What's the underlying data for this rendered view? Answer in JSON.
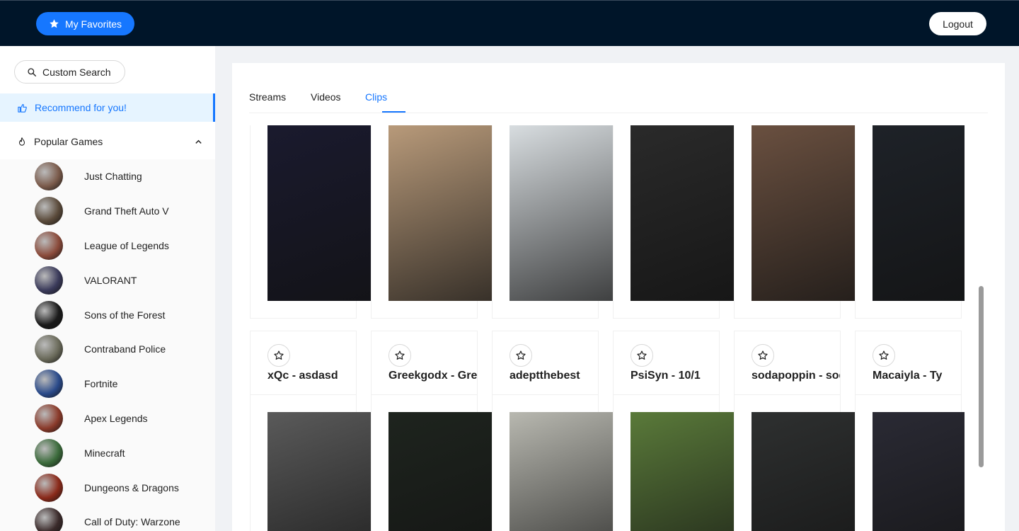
{
  "header": {
    "favorites_label": "My Favorites",
    "logout_label": "Logout"
  },
  "sidebar": {
    "custom_search_label": "Custom Search",
    "recommend_label": "Recommend for you!",
    "popular_label": "Popular Games",
    "games": [
      {
        "name": "Just Chatting",
        "color": "#7a5a4a"
      },
      {
        "name": "Grand Theft Auto V",
        "color": "#5a4a3a"
      },
      {
        "name": "League of Legends",
        "color": "#8a4a3a"
      },
      {
        "name": "VALORANT",
        "color": "#3a3a5a"
      },
      {
        "name": "Sons of the Forest",
        "color": "#1a1a1a"
      },
      {
        "name": "Contraband Police",
        "color": "#6a6a5a"
      },
      {
        "name": "Fortnite",
        "color": "#2a4a8a"
      },
      {
        "name": "Apex Legends",
        "color": "#8a3a2a"
      },
      {
        "name": "Minecraft",
        "color": "#3a6a3a"
      },
      {
        "name": "Dungeons & Dragons",
        "color": "#8a2a1a"
      },
      {
        "name": "Call of Duty: Warzone",
        "color": "#3a2a2a"
      }
    ]
  },
  "tabs": [
    "Streams",
    "Videos",
    "Clips"
  ],
  "active_tab": "Clips",
  "clips": [
    {
      "title": "xQc - asdasd",
      "thumb": "#1a1a2e"
    },
    {
      "title": "Greekgodx - Greekgodx",
      "thumb": "#b89a7a"
    },
    {
      "title": "adeptthebest",
      "thumb": "#d8dde0"
    },
    {
      "title": "PsiSyn - 10/1",
      "thumb": "#2a2a2a"
    },
    {
      "title": "sodapoppin - sodapoppin",
      "thumb": "#6a5040"
    },
    {
      "title": "Macaiyla - Ty",
      "thumb": "#1e2228"
    }
  ],
  "next_row_thumbs": [
    "#5a5a5a",
    "#1e241e",
    "#b8b8b0",
    "#5a7a3a",
    "#2e3030",
    "#2a2a34"
  ]
}
